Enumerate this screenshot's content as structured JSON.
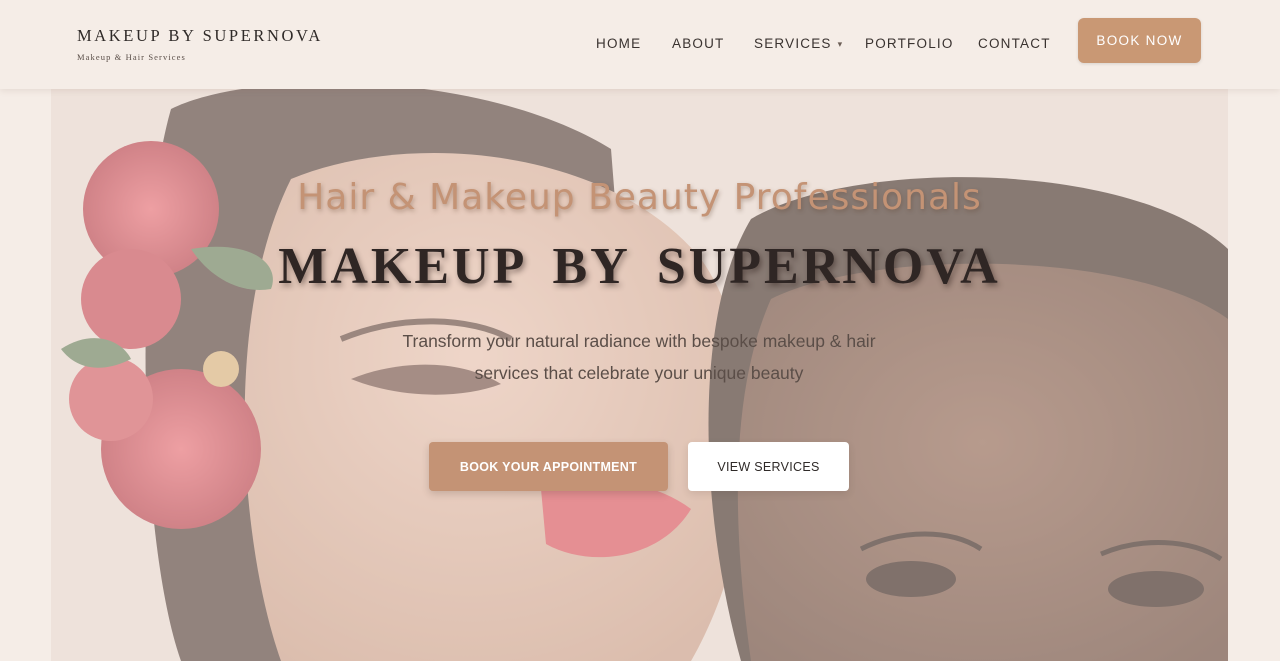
{
  "header": {
    "brand_name": "MAKEUP BY SUPERNOVA",
    "brand_tagline": "Makeup & Hair Services",
    "nav": [
      {
        "label": "HOME"
      },
      {
        "label": "ABOUT"
      },
      {
        "label": "SERVICES",
        "has_dropdown": true,
        "caret": "▾"
      },
      {
        "label": "PORTFOLIO"
      },
      {
        "label": "CONTACT"
      }
    ],
    "cta_label": "BOOK NOW"
  },
  "hero": {
    "eyebrow": "Hair & Makeup Beauty Professionals",
    "title": "MAKEUP BY SUPERNOVA",
    "subtitle": "Transform your natural radiance with bespoke makeup & hair services that celebrate your unique beauty",
    "primary_button": "BOOK YOUR APPOINTMENT",
    "secondary_button": "VIEW SERVICES",
    "image_subject": "two-models-portrait"
  },
  "colors": {
    "page_background": "#f5ede7",
    "accent": "#c99874",
    "title_text": "#2f2624",
    "body_text": "#5b4e48",
    "white": "#ffffff"
  }
}
